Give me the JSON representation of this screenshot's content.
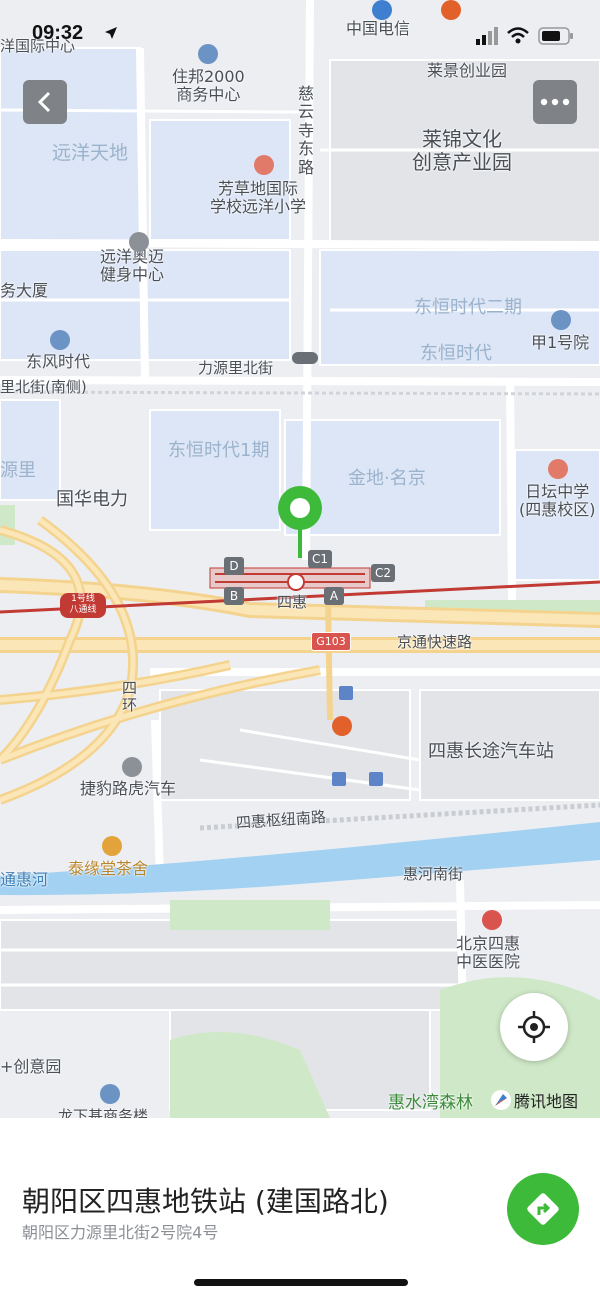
{
  "status_bar": {
    "time": "09:32"
  },
  "map": {
    "places": [
      {
        "id": "p01",
        "text": "住邦2000\n商务中心"
      },
      {
        "id": "p02",
        "text": "中国电信"
      },
      {
        "id": "p03",
        "text": "莱景创业园"
      },
      {
        "id": "p04",
        "text": "远洋天地"
      },
      {
        "id": "p05",
        "text": "慈\n云\n寺\n东\n路"
      },
      {
        "id": "p06",
        "text": "莱锦文化\n创意产业园"
      },
      {
        "id": "p07",
        "text": "芳草地国际\n学校远洋小学"
      },
      {
        "id": "p08",
        "text": "远洋奥迈\n健身中心"
      },
      {
        "id": "p09",
        "text": "务大厦"
      },
      {
        "id": "p10",
        "text": "东恒时代二期"
      },
      {
        "id": "p11",
        "text": "东风时代"
      },
      {
        "id": "p12",
        "text": "东恒时代"
      },
      {
        "id": "p13",
        "text": "甲1号院"
      },
      {
        "id": "p14",
        "text": "力源里北街"
      },
      {
        "id": "p15",
        "text": "里北街(南侧)"
      },
      {
        "id": "p16",
        "text": "东恒时代1期"
      },
      {
        "id": "p17",
        "text": "源里"
      },
      {
        "id": "p18",
        "text": "金地·名京"
      },
      {
        "id": "p19",
        "text": "日坛中学\n(四惠校区)"
      },
      {
        "id": "p20",
        "text": "国华电力"
      },
      {
        "id": "p21",
        "text": "四惠"
      },
      {
        "id": "p22",
        "text": "京通快速路"
      },
      {
        "id": "p23",
        "text": "四\n环"
      },
      {
        "id": "p24",
        "text": "四惠长途汽车站"
      },
      {
        "id": "p25",
        "text": "捷豹路虎汽车"
      },
      {
        "id": "p26",
        "text": "四惠枢纽南路"
      },
      {
        "id": "p27",
        "text": "泰缘堂茶舍"
      },
      {
        "id": "p28",
        "text": "通惠河"
      },
      {
        "id": "p29",
        "text": "惠河南街"
      },
      {
        "id": "p30",
        "text": "北京四惠\n中医医院"
      },
      {
        "id": "p31",
        "text": "+创意园"
      },
      {
        "id": "p32",
        "text": "惠水湾森林"
      },
      {
        "id": "p33",
        "text": "龙下基商务楼"
      },
      {
        "id": "p34",
        "text": "洋国际中心"
      }
    ],
    "line_badge": "1号线\n八通线",
    "highway_badge": "G103",
    "exits": [
      "D",
      "C1",
      "C2",
      "B",
      "A"
    ],
    "logo_text": "腾讯地图"
  },
  "place": {
    "title": "朝阳区四惠地铁站 (建国路北)",
    "address": "朝阳区力源里北街2号院4号"
  },
  "colors": {
    "accent": "#3dba3a",
    "subway": "#c23a34",
    "river": "#a3d1f2",
    "block": "#dde6f6",
    "expressway": "#f7dca0"
  }
}
